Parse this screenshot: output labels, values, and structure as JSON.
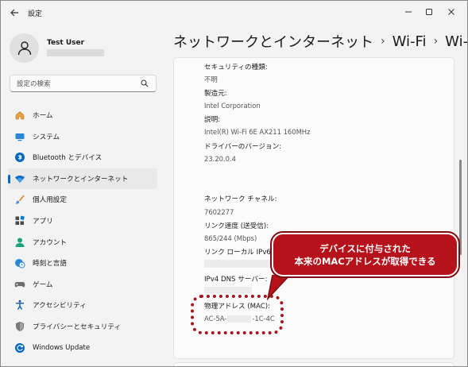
{
  "titlebar": {
    "title": "設定"
  },
  "user": {
    "name": "Test User"
  },
  "search": {
    "placeholder": "設定の検索"
  },
  "nav": [
    {
      "label": "ホーム",
      "icon": "home-icon"
    },
    {
      "label": "システム",
      "icon": "system-icon"
    },
    {
      "label": "Bluetooth とデバイス",
      "icon": "bluetooth-icon"
    },
    {
      "label": "ネットワークとインターネット",
      "icon": "wifi-icon"
    },
    {
      "label": "個人用設定",
      "icon": "brush-icon"
    },
    {
      "label": "アプリ",
      "icon": "apps-icon"
    },
    {
      "label": "アカウント",
      "icon": "person-icon"
    },
    {
      "label": "時刻と言語",
      "icon": "clock-globe-icon"
    },
    {
      "label": "ゲーム",
      "icon": "gamepad-icon"
    },
    {
      "label": "アクセシビリティ",
      "icon": "accessibility-icon"
    },
    {
      "label": "プライバシーとセキュリティ",
      "icon": "shield-icon"
    },
    {
      "label": "Windows Update",
      "icon": "update-icon"
    }
  ],
  "breadcrumb": [
    "ネットワークとインターネット",
    "Wi-Fi",
    "Wi-Fi"
  ],
  "properties": {
    "security_type": {
      "label": "セキュリティの種類:",
      "value": "不明"
    },
    "manufacturer": {
      "label": "製造元:",
      "value": "Intel Corporation"
    },
    "description": {
      "label": "説明:",
      "value": "Intel(R) Wi-Fi 6E AX211 160MHz"
    },
    "driver_version": {
      "label": "ドライバーのバージョン:",
      "value": "23.20.0.4"
    },
    "channel": {
      "label": "ネットワーク チャネル:",
      "value": "7602277"
    },
    "link_speed": {
      "label": "リンク速度 (送受信):",
      "value": "865/244 (Mbps)"
    },
    "ipv6": {
      "label": "リンク ローカル IPv6 ア"
    },
    "ipv4_dns": {
      "label": "IPv4 DNS サーバー:"
    },
    "mac": {
      "label": "物理アドレス (MAC):",
      "value_prefix": "AC-5A-",
      "value_suffix": "-1C-4C"
    }
  },
  "callout": {
    "line1": "デバイスに付与された",
    "line2": "本来のMACアドレスが取得できる"
  },
  "colors": {
    "accent": "#0067c0",
    "callout": "#b5121b"
  }
}
